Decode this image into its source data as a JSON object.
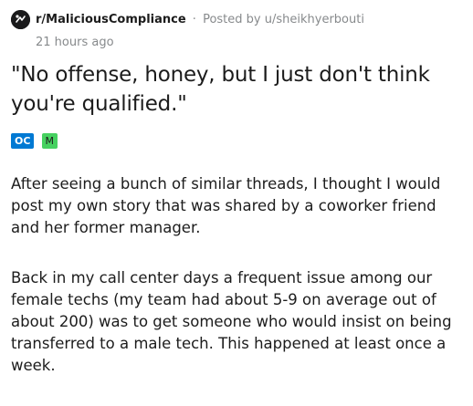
{
  "post": {
    "subreddit": "r/MaliciousCompliance",
    "separator": "·",
    "posted_by_prefix": "Posted by",
    "username": "u/sheikhyerbouti",
    "time": "21 hours ago",
    "title": "\"No offense, honey, but I just don't think you're qualified.\"",
    "flairs": [
      {
        "label": "OC",
        "color": "#0079d3"
      },
      {
        "label": "M",
        "color": "#46d160"
      }
    ],
    "paragraphs": [
      "After seeing a bunch of similar threads, I thought I would post my own story that was shared by a coworker friend and her former manager.",
      "Back in my call center days a frequent issue among our female techs (my team had about 5-9 on average out of about 200) was to get someone who would insist on being transferred to a male tech. This happened at least once a week."
    ]
  },
  "colors": {
    "text": "#1c1c1c",
    "meta": "#878a8c",
    "subreddit_icon": "#1a1a1b"
  },
  "icons": {
    "subreddit": "subreddit-icon"
  }
}
